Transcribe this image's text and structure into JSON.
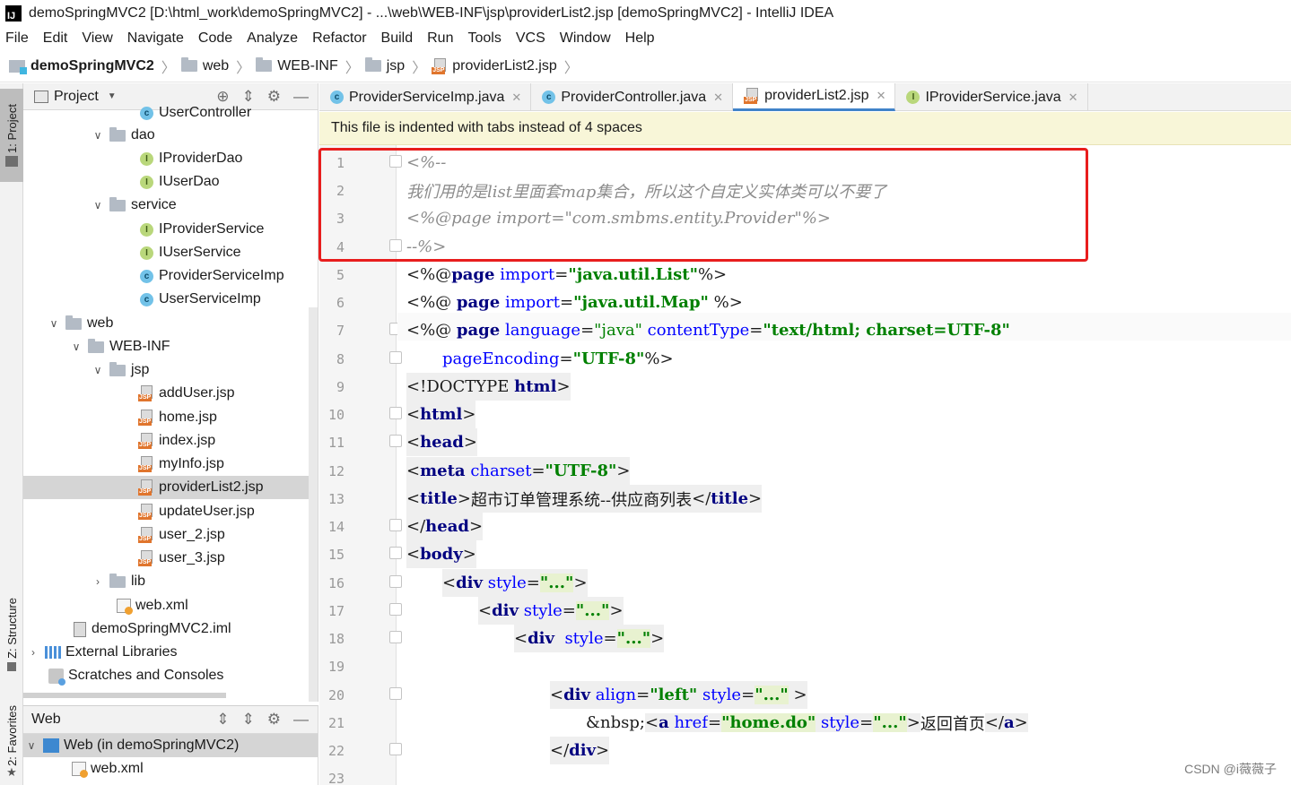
{
  "window": {
    "title": "demoSpringMVC2 [D:\\html_work\\demoSpringMVC2] - ...\\web\\WEB-INF\\jsp\\providerList2.jsp [demoSpringMVC2] - IntelliJ IDEA",
    "logo_text": "IJ"
  },
  "menu": [
    "File",
    "Edit",
    "View",
    "Navigate",
    "Code",
    "Analyze",
    "Refactor",
    "Build",
    "Run",
    "Tools",
    "VCS",
    "Window",
    "Help"
  ],
  "breadcrumb": [
    "demoSpringMVC2",
    "web",
    "WEB-INF",
    "jsp",
    "providerList2.jsp"
  ],
  "stripe": {
    "project": "1: Project",
    "structure": "Z: Structure",
    "favorites": "2: Favorites"
  },
  "project_panel": {
    "title": "Project",
    "partial_item": "UserController",
    "items": [
      {
        "label": "dao",
        "type": "folder",
        "expanded": true
      },
      {
        "label": "IProviderDao",
        "type": "interface"
      },
      {
        "label": "IUserDao",
        "type": "interface"
      },
      {
        "label": "service",
        "type": "folder",
        "expanded": true
      },
      {
        "label": "IProviderService",
        "type": "interface"
      },
      {
        "label": "IUserService",
        "type": "interface"
      },
      {
        "label": "ProviderServiceImp",
        "type": "class"
      },
      {
        "label": "UserServiceImp",
        "type": "class"
      },
      {
        "label": "web",
        "type": "folder",
        "expanded": true
      },
      {
        "label": "WEB-INF",
        "type": "folder",
        "expanded": true
      },
      {
        "label": "jsp",
        "type": "folder",
        "expanded": true
      },
      {
        "label": "addUser.jsp",
        "type": "jsp"
      },
      {
        "label": "home.jsp",
        "type": "jsp"
      },
      {
        "label": "index.jsp",
        "type": "jsp"
      },
      {
        "label": "myInfo.jsp",
        "type": "jsp"
      },
      {
        "label": "providerList2.jsp",
        "type": "jsp",
        "selected": true
      },
      {
        "label": "updateUser.jsp",
        "type": "jsp"
      },
      {
        "label": "user_2.jsp",
        "type": "jsp"
      },
      {
        "label": "user_3.jsp",
        "type": "jsp"
      },
      {
        "label": "lib",
        "type": "folder",
        "expanded": false
      },
      {
        "label": "web.xml",
        "type": "xml"
      },
      {
        "label": "demoSpringMVC2.iml",
        "type": "iml"
      },
      {
        "label": "External Libraries",
        "type": "libraries"
      },
      {
        "label": "Scratches and Consoles",
        "type": "scratches"
      }
    ]
  },
  "web_panel": {
    "title": "Web",
    "items": [
      {
        "label": "Web (in demoSpringMVC2)",
        "selected": true
      },
      {
        "label": "web.xml"
      }
    ]
  },
  "tabs": [
    {
      "label": "ProviderServiceImp.java",
      "icon": "class"
    },
    {
      "label": "ProviderController.java",
      "icon": "class"
    },
    {
      "label": "providerList2.jsp",
      "icon": "jsp",
      "active": true
    },
    {
      "label": "IProviderService.java",
      "icon": "interface"
    }
  ],
  "notice": "This file is indented with tabs instead of 4 spaces",
  "editor": {
    "line_numbers": [
      "1",
      "2",
      "3",
      "4",
      "5",
      "6",
      "7",
      "8",
      "9",
      "10",
      "11",
      "12",
      "13",
      "14",
      "15",
      "16",
      "17",
      "18",
      "19",
      "20",
      "21",
      "22",
      "23"
    ],
    "lines": {
      "l1": "<%--",
      "l2": "我们用的是list里面套map集合，所以这个自定义实体类可以不要了",
      "l3": "<%@page import=\"com.smbms.entity.Provider\"%>",
      "l4": "--%>",
      "l5a": "<%@",
      "l5b": "page",
      "l5c": "import",
      "l5d": "=",
      "l5e": "\"java.util.List\"",
      "l5f": "%>",
      "l6a": "<%@ ",
      "l6b": "page",
      "l6c": "import",
      "l6d": "=",
      "l6e": "\"java.util.Map\"",
      "l6f": " %>",
      "l7a": "<%@ ",
      "l7b": "page",
      "l7c": "language",
      "l7d": "=",
      "l7e": "\"java\"",
      "l7f": " ",
      "l7g": "contentType",
      "l7h": "=",
      "l7i": "\"text/html; charset=UTF-8\"",
      "l8a": "pageEncoding",
      "l8b": "=",
      "l8c": "\"UTF-8\"",
      "l8d": "%>",
      "l9a": "<!DOCTYPE ",
      "l9b": "html",
      "l9c": ">",
      "l10a": "<",
      "l10b": "html",
      "l10c": ">",
      "l11a": "<",
      "l11b": "head",
      "l11c": ">",
      "l12a": "<",
      "l12b": "meta",
      "l12c": " ",
      "l12d": "charset",
      "l12e": "=",
      "l12f": "\"UTF-8\"",
      "l12g": ">",
      "l13a": "<",
      "l13b": "title",
      "l13c": ">",
      "l13d": "超市订单管理系统--供应商列表",
      "l13e": "</",
      "l13f": "title",
      "l13g": ">",
      "l14a": "</",
      "l14b": "head",
      "l14c": ">",
      "l15a": "<",
      "l15b": "body",
      "l15c": ">",
      "l16a": "<",
      "l16b": "div",
      "l16c": " ",
      "l16d": "style",
      "l16e": "=",
      "l16f": "\"...\"",
      "l16g": ">",
      "l17a": "<",
      "l17b": "div",
      "l17c": " ",
      "l17d": "style",
      "l17e": "=",
      "l17f": "\"...\"",
      "l17g": ">",
      "l18a": "<",
      "l18b": "div",
      "l18c": "  ",
      "l18d": "style",
      "l18e": "=",
      "l18f": "\"...\"",
      "l18g": ">",
      "l20a": "<",
      "l20b": "div",
      "l20c": " ",
      "l20d": "align",
      "l20e": "=",
      "l20f": "\"left\"",
      "l20g": " ",
      "l20h": "style",
      "l20i": "=",
      "l20j": "\"...\"",
      "l20k": " >",
      "l21a": "&nbsp;",
      "l21b": "<",
      "l21c": "a",
      "l21d": " ",
      "l21e": "href",
      "l21f": "=",
      "l21g": "\"home.do\"",
      "l21h": " ",
      "l21i": "style",
      "l21j": "=",
      "l21k": "\"...\"",
      "l21l": ">",
      "l21m": "返回首页",
      "l21n": "</",
      "l21o": "a",
      "l21p": ">",
      "l22a": "</",
      "l22b": "div",
      "l22c": ">"
    }
  },
  "watermark": "CSDN @i薇薇子"
}
